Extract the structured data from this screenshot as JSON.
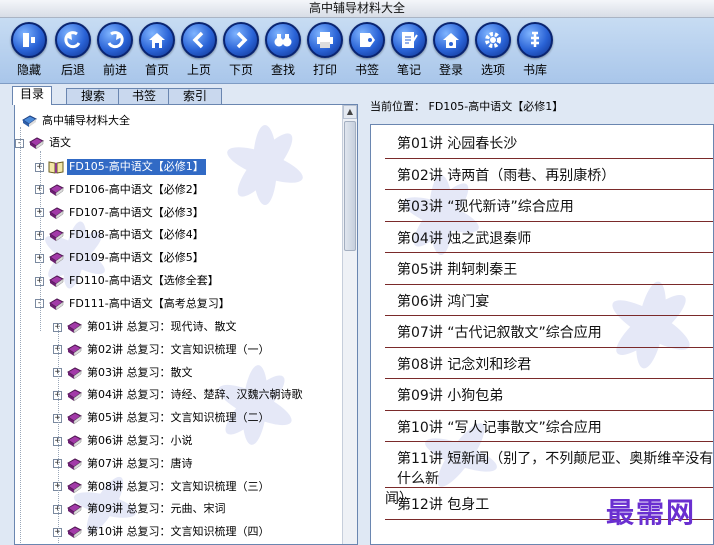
{
  "window": {
    "title": "高中辅导材料大全"
  },
  "toolbar": {
    "buttons": [
      {
        "label": "隐藏",
        "icon": "hide-icon"
      },
      {
        "label": "后退",
        "icon": "back-icon"
      },
      {
        "label": "前进",
        "icon": "forward-icon"
      },
      {
        "label": "首页",
        "icon": "home-icon"
      },
      {
        "label": "上页",
        "icon": "prev-page-icon"
      },
      {
        "label": "下页",
        "icon": "next-page-icon"
      },
      {
        "label": "查找",
        "icon": "binoculars-icon"
      },
      {
        "label": "打印",
        "icon": "printer-icon"
      },
      {
        "label": "书签",
        "icon": "bookmark-icon"
      },
      {
        "label": "笔记",
        "icon": "notes-icon"
      },
      {
        "label": "登录",
        "icon": "login-icon"
      },
      {
        "label": "选项",
        "icon": "options-gear-icon"
      },
      {
        "label": "书库",
        "icon": "library-icon"
      }
    ]
  },
  "tabs": [
    {
      "label": "目录"
    },
    {
      "label": "搜索"
    },
    {
      "label": "书签"
    },
    {
      "label": "索引"
    }
  ],
  "tree": {
    "root": "高中辅导材料大全",
    "subject": "语文",
    "books": [
      {
        "label": "FD105-高中语文【必修1】",
        "selected": true,
        "open": true
      },
      {
        "label": "FD106-高中语文【必修2】"
      },
      {
        "label": "FD107-高中语文【必修3】"
      },
      {
        "label": "FD108-高中语文【必修4】"
      },
      {
        "label": "FD109-高中语文【必修5】"
      },
      {
        "label": "FD110-高中语文【选修全套】"
      },
      {
        "label": "FD111-高中语文【高考总复习】"
      }
    ],
    "review_items": [
      "第01讲 总复习：现代诗、散文",
      "第02讲 总复习：文言知识梳理（一）",
      "第03讲 总复习：散文",
      "第04讲 总复习：诗经、楚辞、汉魏六朝诗歌",
      "第05讲 总复习：文言知识梳理（二）",
      "第06讲 总复习：小说",
      "第07讲 总复习：唐诗",
      "第08讲 总复习：文言知识梳理（三）",
      "第09讲 总复习：元曲、宋词",
      "第10讲 总复习：文言知识梳理（四）"
    ]
  },
  "content": {
    "location": "当前位置： FD105-高中语文【必修1】",
    "lessons": [
      [
        "第01讲 沁园春长沙"
      ],
      [
        "第02讲 诗两首（雨巷、再别康桥）"
      ],
      [
        "第03讲 “现代新诗”综合应用"
      ],
      [
        "第04讲 烛之武退秦师"
      ],
      [
        "第05讲 荆轲刺秦王"
      ],
      [
        "第06讲 鸿门宴"
      ],
      [
        "第07讲 “古代记叙散文”综合应用"
      ],
      [
        "第08讲 记念刘和珍君"
      ],
      [
        "第09讲 小狗包弟"
      ],
      [
        "第10讲 “写人记事散文”综合应用"
      ],
      [
        "第11讲 短新闻（别了，不列颠尼亚、奥斯维辛没有什么新",
        "闻）"
      ],
      [
        "第12讲 包身工"
      ]
    ]
  },
  "watermark": "最需网"
}
